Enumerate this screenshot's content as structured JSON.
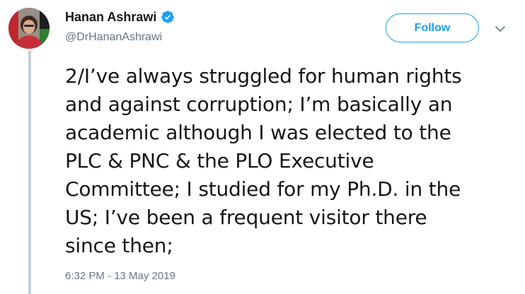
{
  "author": {
    "display_name": "Hanan Ashrawi",
    "handle": "@DrHananAshrawi",
    "verified": true
  },
  "actions": {
    "follow_label": "Follow"
  },
  "tweet": {
    "lines": [
      "2/I’ve always struggled for human rights",
      "and against corruption; I’m basically an",
      "academic although I was elected to the",
      "PLC & PNC & the PLO Executive",
      "Committee; I studied for my Ph.D. in the",
      "US; I’ve been a frequent visitor there",
      "since then;"
    ],
    "timestamp": "6:32 PM - 13 May 2019"
  },
  "colors": {
    "accent": "#1da1f2",
    "secondary_text": "#657786",
    "primary_text": "#14171a",
    "thread_line": "#c4cfd6"
  },
  "icons": {
    "verified": "verified-badge-icon",
    "menu": "chevron-down-icon"
  }
}
